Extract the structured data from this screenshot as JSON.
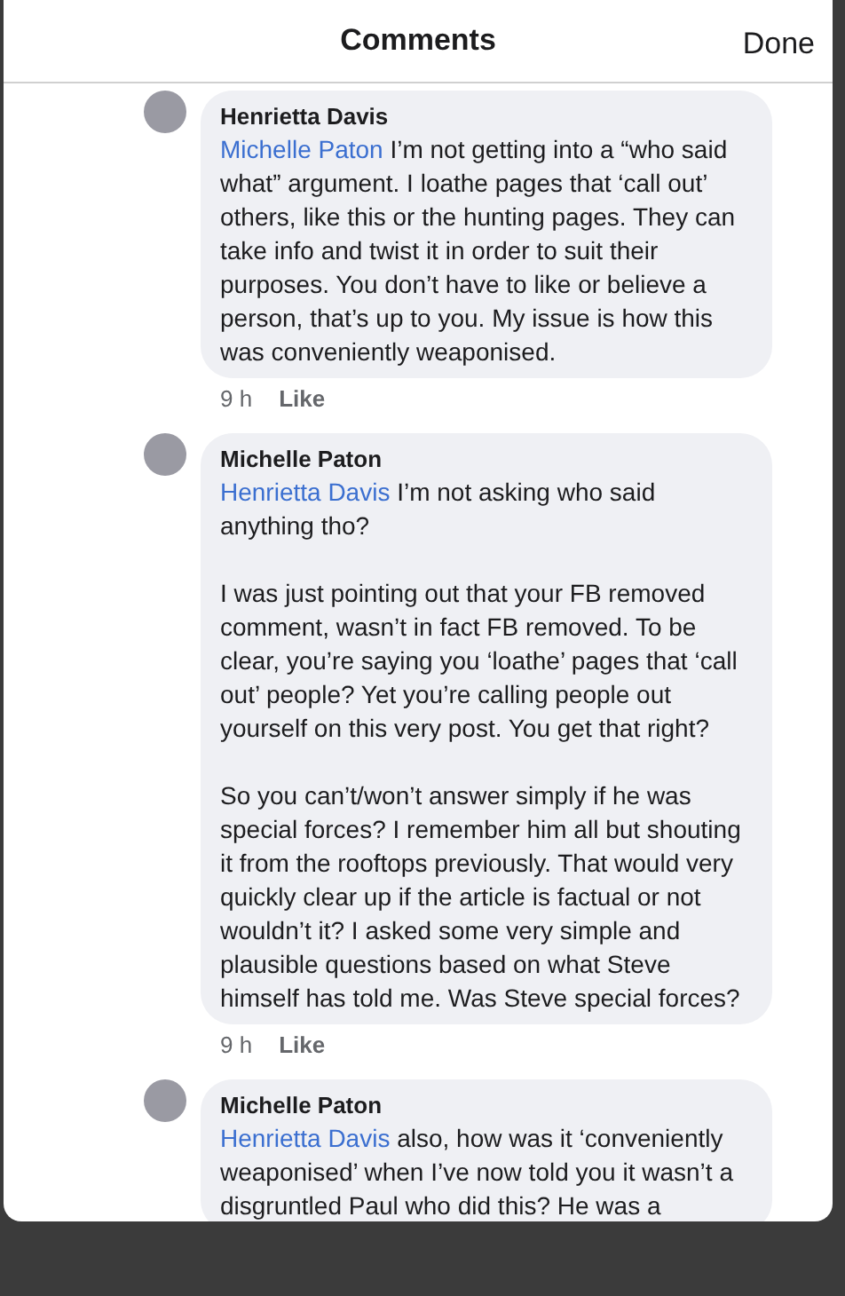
{
  "header": {
    "title": "Comments",
    "done": "Done"
  },
  "comments": [
    {
      "author": "Henrietta Davis",
      "paragraphs": [
        {
          "mention": "Michelle Paton",
          "text": "I’m not getting into a “who said what” argument. I loathe pages that ‘call out’ others, like this or the hunting pages. They can take info and twist it in order to suit their purposes. You don’t have to like or believe a person, that’s up to you. My issue is how this was conveniently weaponised."
        }
      ],
      "time": "9 h",
      "like": "Like"
    },
    {
      "author": "Michelle Paton",
      "paragraphs": [
        {
          "mention": "Henrietta Davis",
          "text": "I’m not asking who said anything tho?"
        },
        {
          "text": "I was just pointing out that your FB removed comment, wasn’t in fact FB removed. To be clear, you’re saying you ‘loathe’ pages that ‘call out’ people? Yet you’re calling people out yourself on this very post. You get that right?"
        },
        {
          "text": "So you can’t/won’t answer simply if he was special forces? I remember him all but shouting it from the rooftops previously. That would very quickly clear up if the article is factual or not wouldn’t it? I asked some very simple and plausible questions based on what Steve himself has told me. Was Steve special forces?"
        }
      ],
      "time": "9 h",
      "like": "Like"
    },
    {
      "author": "Michelle Paton",
      "paragraphs": [
        {
          "mention": "Henrietta Davis",
          "text": "also, how was it ‘conveniently weaponised’ when I’ve now told you it wasn’t a disgruntled Paul who did this? He was a"
        }
      ]
    }
  ]
}
